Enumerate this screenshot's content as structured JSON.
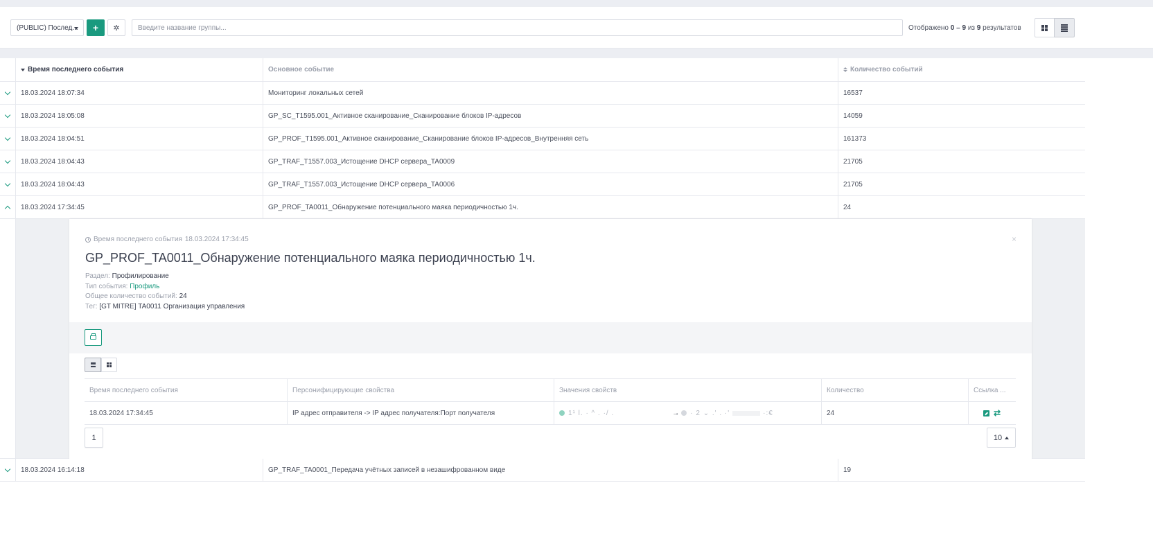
{
  "toolbar": {
    "group_select": "(PUBLIC) Послед...",
    "add_label": "+",
    "search_placeholder": "Введите название группы...",
    "results_prefix": "Отображено",
    "results_range": "0 – 9",
    "results_mid": "из",
    "results_total": "9",
    "results_suffix": "результатов"
  },
  "table": {
    "columns": [
      "Время последнего события",
      "Основное событие",
      "Количество событий"
    ],
    "rows": [
      {
        "time": "18.03.2024 18:07:34",
        "event": "Мониторинг локальных сетей",
        "count": "16537"
      },
      {
        "time": "18.03.2024 18:05:08",
        "event": "GP_SC_T1595.001_Активное сканирование_Сканирование блоков IP-адресов",
        "count": "14059"
      },
      {
        "time": "18.03.2024 18:04:51",
        "event": "GP_PROF_T1595.001_Активное сканирование_Сканирование блоков IP-адресов_Внутренняя сеть",
        "count": "161373"
      },
      {
        "time": "18.03.2024 18:04:43",
        "event": "GP_TRAF_T1557.003_Истощение DHCP сервера_TA0009",
        "count": "21705"
      },
      {
        "time": "18.03.2024 18:04:43",
        "event": "GP_TRAF_T1557.003_Истощение DHCP сервера_TA0006",
        "count": "21705"
      },
      {
        "time": "18.03.2024 17:34:45",
        "event": "GP_PROF_TA0011_Обнаружение потенциального маяка периодичностью 1ч.",
        "count": "24"
      },
      {
        "time": "18.03.2024 16:14:18",
        "event": "GP_TRAF_TA0001_Передача учётных записей в незашифрованном виде",
        "count": "19"
      }
    ]
  },
  "detail": {
    "time_label": "Время последнего события",
    "time_value": "18.03.2024 17:34:45",
    "title": "GP_PROF_TA0011_Обнаружение потенциального маяка периодичностью 1ч.",
    "close": "×",
    "section_label": "Раздел:",
    "section_value": "Профилирование",
    "type_label": "Тип события:",
    "type_value": "Профиль",
    "total_label": "Общее количество событий:",
    "total_value": "24",
    "tag_label": "Тег:",
    "tag_value": "[GT MITRE] TA0011 Организация управления",
    "sub_columns": [
      "Время последнего события",
      "Персонифицирующие свойства",
      "Значения свойств",
      "Количество",
      "Ссылка ..."
    ],
    "sub_row": {
      "time": "18.03.2024 17:34:45",
      "props": "IP адрес отправителя -> IP адрес получателя:Порт получателя",
      "value_a": "1¹  l. · ^ . ·/ .",
      "arrow": "→",
      "value_b": "·  2   ⌄ .'   . ·'",
      "value_c": "·:€",
      "count": "24"
    },
    "page": "1",
    "page_size": "10"
  },
  "colors": {
    "accent": "#1a9a7f",
    "text": "#4a4f5c",
    "muted": "#9a9fab"
  },
  "icons": [
    "caret-down-icon",
    "plus-icon",
    "gear-icon",
    "grid-view-icon",
    "list-view-icon",
    "chevron-down-icon",
    "chevron-up-icon",
    "clock-icon",
    "close-icon",
    "printer-icon",
    "external-link-icon",
    "swap-icon"
  ]
}
